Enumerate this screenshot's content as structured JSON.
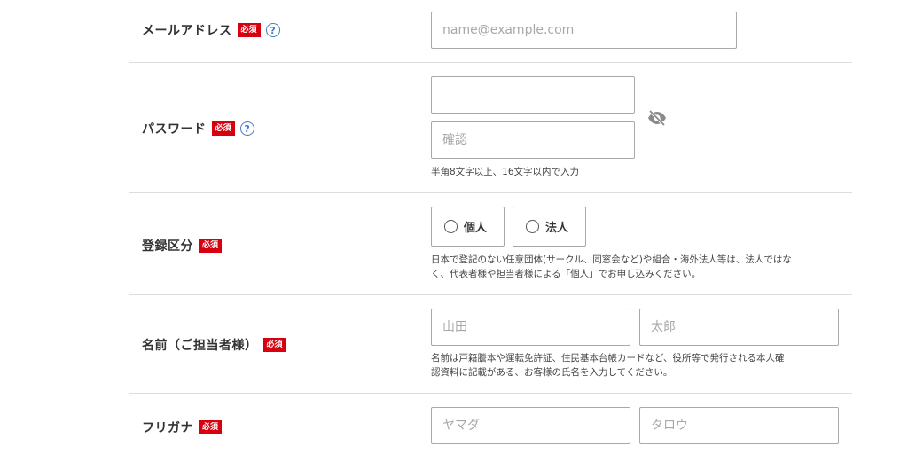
{
  "email": {
    "label": "メールアドレス",
    "required": "必須",
    "help": "?",
    "placeholder": "name@example.com"
  },
  "password": {
    "label": "パスワード",
    "required": "必須",
    "help": "?",
    "placeholder": "",
    "confirm_placeholder": "確認",
    "hint": "半角8文字以上、16文字以内で入力",
    "visibility_icon": "eye-off-icon"
  },
  "registration_type": {
    "label": "登録区分",
    "required": "必須",
    "options": [
      {
        "label": "個人",
        "selected": false
      },
      {
        "label": "法人",
        "selected": false
      }
    ],
    "hint_line1": "日本で登記のない任意団体(サークル、同窓会など)や組合・海外法人等は、法人ではな",
    "hint_line2": "く、代表者様や担当者様による「個人」でお申し込みください。"
  },
  "name": {
    "label": "名前（ご担当者様）",
    "required": "必須",
    "last_placeholder": "山田",
    "first_placeholder": "太郎",
    "hint_line1": "名前は戸籍謄本や運転免許証、住民基本台帳カードなど、役所等で発行される本人確",
    "hint_line2": "認資料に記載がある、お客様の氏名を入力してください。"
  },
  "furigana": {
    "label": "フリガナ",
    "required": "必須",
    "last_placeholder": "ヤマダ",
    "first_placeholder": "タロウ"
  },
  "colors": {
    "required_badge": "#d6000f",
    "help_icon": "#4a7bbf",
    "border": "#a9a9a9",
    "divider": "#dddddd"
  }
}
